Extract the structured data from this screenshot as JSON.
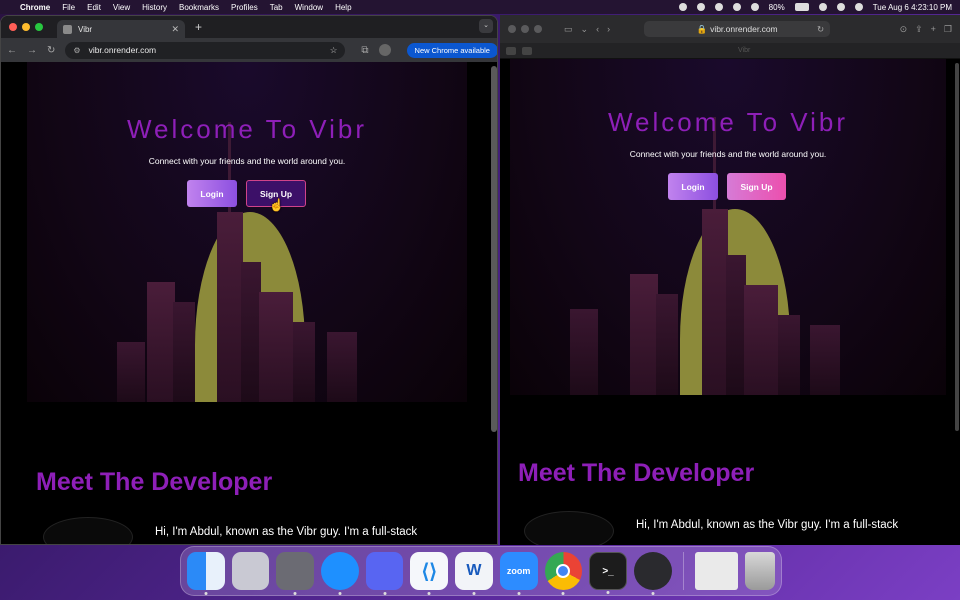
{
  "menubar": {
    "app": "Chrome",
    "items": [
      "File",
      "Edit",
      "View",
      "History",
      "Bookmarks",
      "Profiles",
      "Tab",
      "Window",
      "Help"
    ],
    "battery": "80%",
    "datetime": "Tue Aug 6  4:23:10 PM"
  },
  "chrome": {
    "tab_title": "Vibr",
    "url": "vibr.onrender.com",
    "update_label": "New Chrome available"
  },
  "safari": {
    "url": "vibr.onrender.com",
    "tab_title": "Vibr"
  },
  "page": {
    "hero_title": "Welcome To Vibr",
    "hero_subtitle": "Connect with your friends and the world around you.",
    "login_label": "Login",
    "signup_label": "Sign Up",
    "dev_title": "Meet The Developer",
    "dev_text": "Hi, I'm Abdul, known as the Vibr guy. I'm a full-stack"
  },
  "dock": {
    "items": [
      "Finder",
      "Launchpad",
      "Pages",
      "Safari",
      "Discord",
      "VS Code",
      "Word",
      "zoom",
      "Chrome",
      "Terminal",
      "QuickTime",
      "Preview",
      "Trash"
    ],
    "zoom_label": "zoom",
    "word_label": "W"
  },
  "colors": {
    "accent_purple": "#8e1fb8",
    "signup_border": "#d0438a",
    "chrome_update": "#0b57d0"
  }
}
